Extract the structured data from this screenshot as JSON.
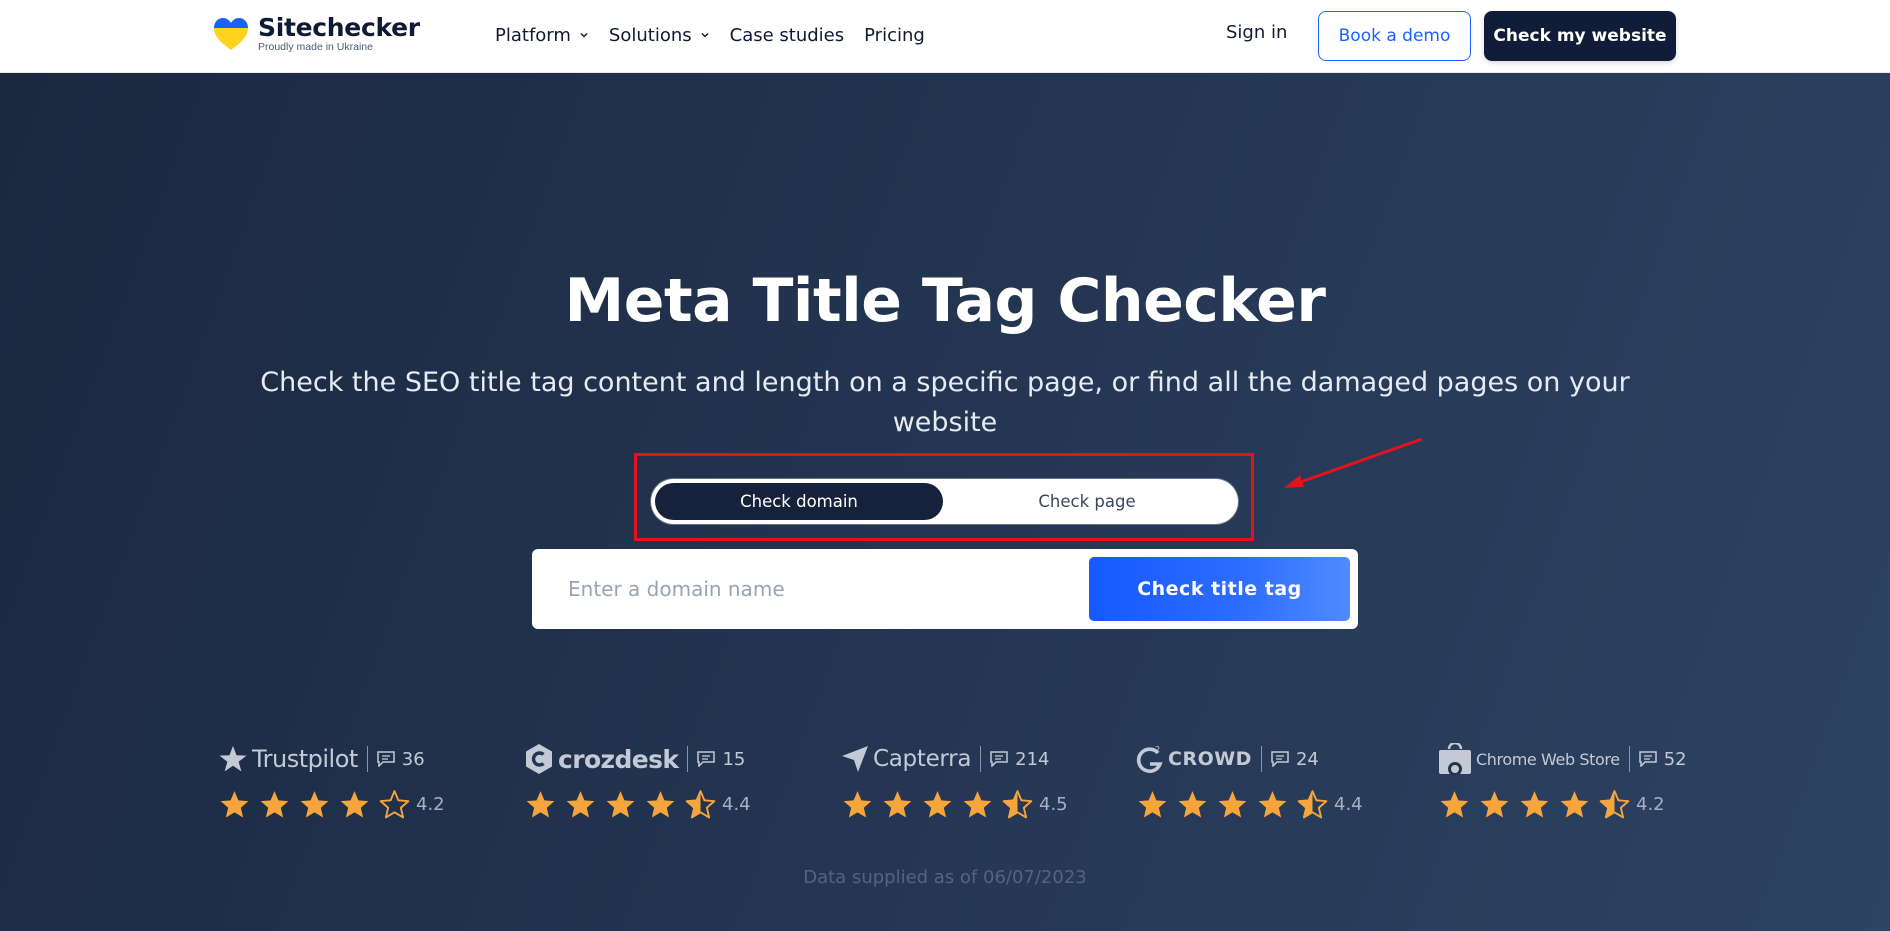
{
  "header": {
    "logo_name": "Sitechecker",
    "logo_tagline": "Proudly made in Ukraine",
    "nav": [
      {
        "label": "Platform",
        "has_dropdown": true
      },
      {
        "label": "Solutions",
        "has_dropdown": true
      },
      {
        "label": "Case studies",
        "has_dropdown": false
      },
      {
        "label": "Pricing",
        "has_dropdown": false
      }
    ],
    "sign_in": "Sign in",
    "book_demo": "Book a demo",
    "check_website": "Check my website"
  },
  "hero": {
    "title": "Meta Title Tag Checker",
    "subtitle": "Check the SEO title tag content and length on a specific page, or find all the damaged pages on your website",
    "toggle": {
      "options": [
        "Check domain",
        "Check page"
      ],
      "selected": "Check domain"
    },
    "search": {
      "placeholder": "Enter a domain name",
      "value": "",
      "button": "Check title tag"
    }
  },
  "reviews": [
    {
      "brand": "Trustpilot",
      "icon": "trustpilot-star-icon",
      "count": "36",
      "rating": "4.2",
      "stars": 4
    },
    {
      "brand": "crozdesk",
      "icon": "crozdesk-icon",
      "count": "15",
      "rating": "4.4",
      "stars": 4.5
    },
    {
      "brand": "Capterra",
      "icon": "capterra-icon",
      "count": "214",
      "rating": "4.5",
      "stars": 4.5
    },
    {
      "brand": "CROWD",
      "icon": "g2-icon",
      "count": "24",
      "rating": "4.4",
      "stars": 4.5
    },
    {
      "brand": "Chrome Web Store",
      "icon": "chrome-web-store-icon",
      "count": "52",
      "rating": "4.2",
      "stars": 4.5
    }
  ],
  "data_note": "Data supplied as of 06/07/2023",
  "colors": {
    "accent": "#1a62ff",
    "navy": "#111d38",
    "star": "#f5a53c",
    "highlight": "#e3121e"
  }
}
